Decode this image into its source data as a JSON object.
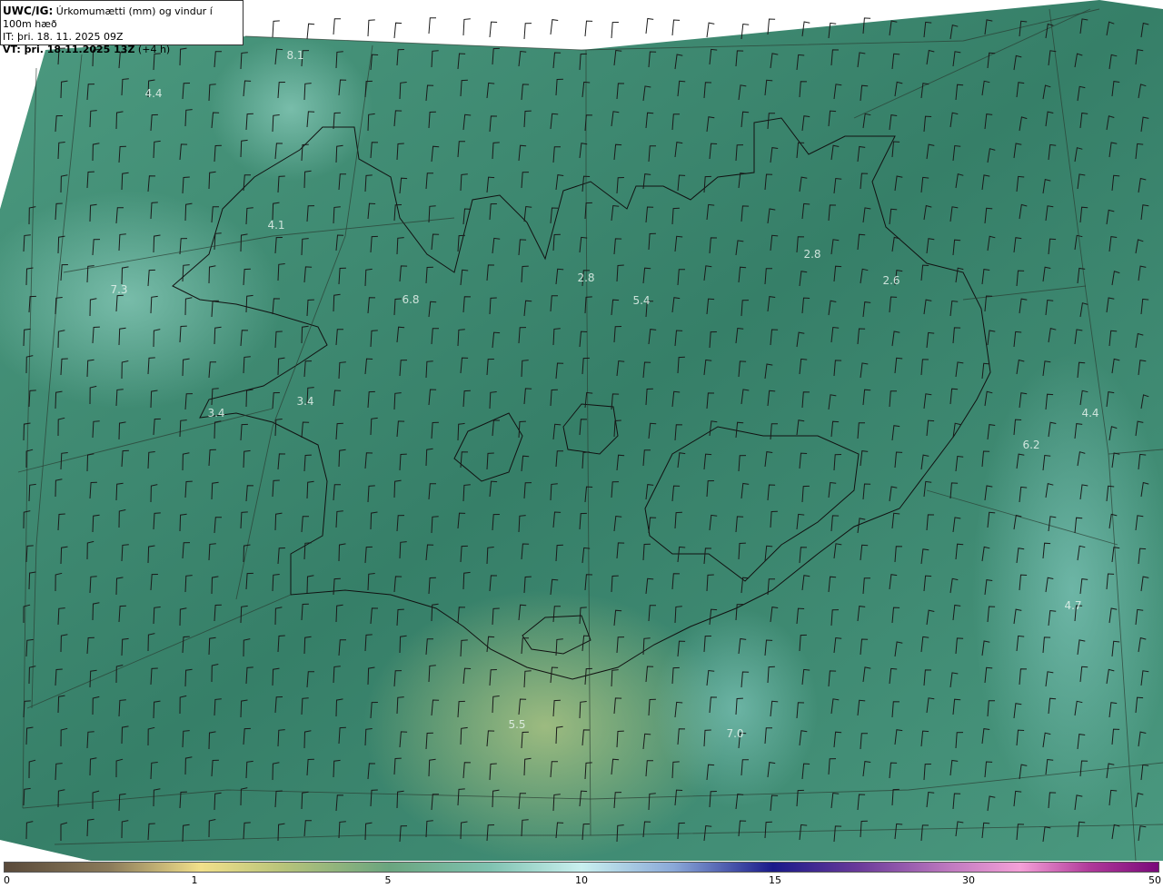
{
  "header": {
    "title_bold": "UWC/IG:",
    "title_rest": " Úrkomumætti (mm) og vindur í 100m hæð",
    "init_time": "IT: þri. 18. 11. 2025 09Z",
    "valid_prefix": "VT:",
    "valid_time_bold": " þri. 18.11.2025 13Z",
    "valid_offset": " (+4 h)"
  },
  "map_values": [
    "8.1",
    "4.4",
    "4.1",
    "7.3",
    "6.8",
    "2.8",
    "5.4",
    "2.8",
    "2.6",
    "3.4",
    "3.4",
    "4.4",
    "6.2",
    "4.7",
    "5.5",
    "7.0"
  ],
  "colorbar": {
    "ticks": [
      "0",
      "1",
      "5",
      "10",
      "15",
      "30",
      "50"
    ]
  },
  "colors": {
    "sea": "#3e8a72",
    "land_low": "#8fbf7a",
    "land_high": "#e6e08a",
    "grid": "#2a3a30"
  }
}
